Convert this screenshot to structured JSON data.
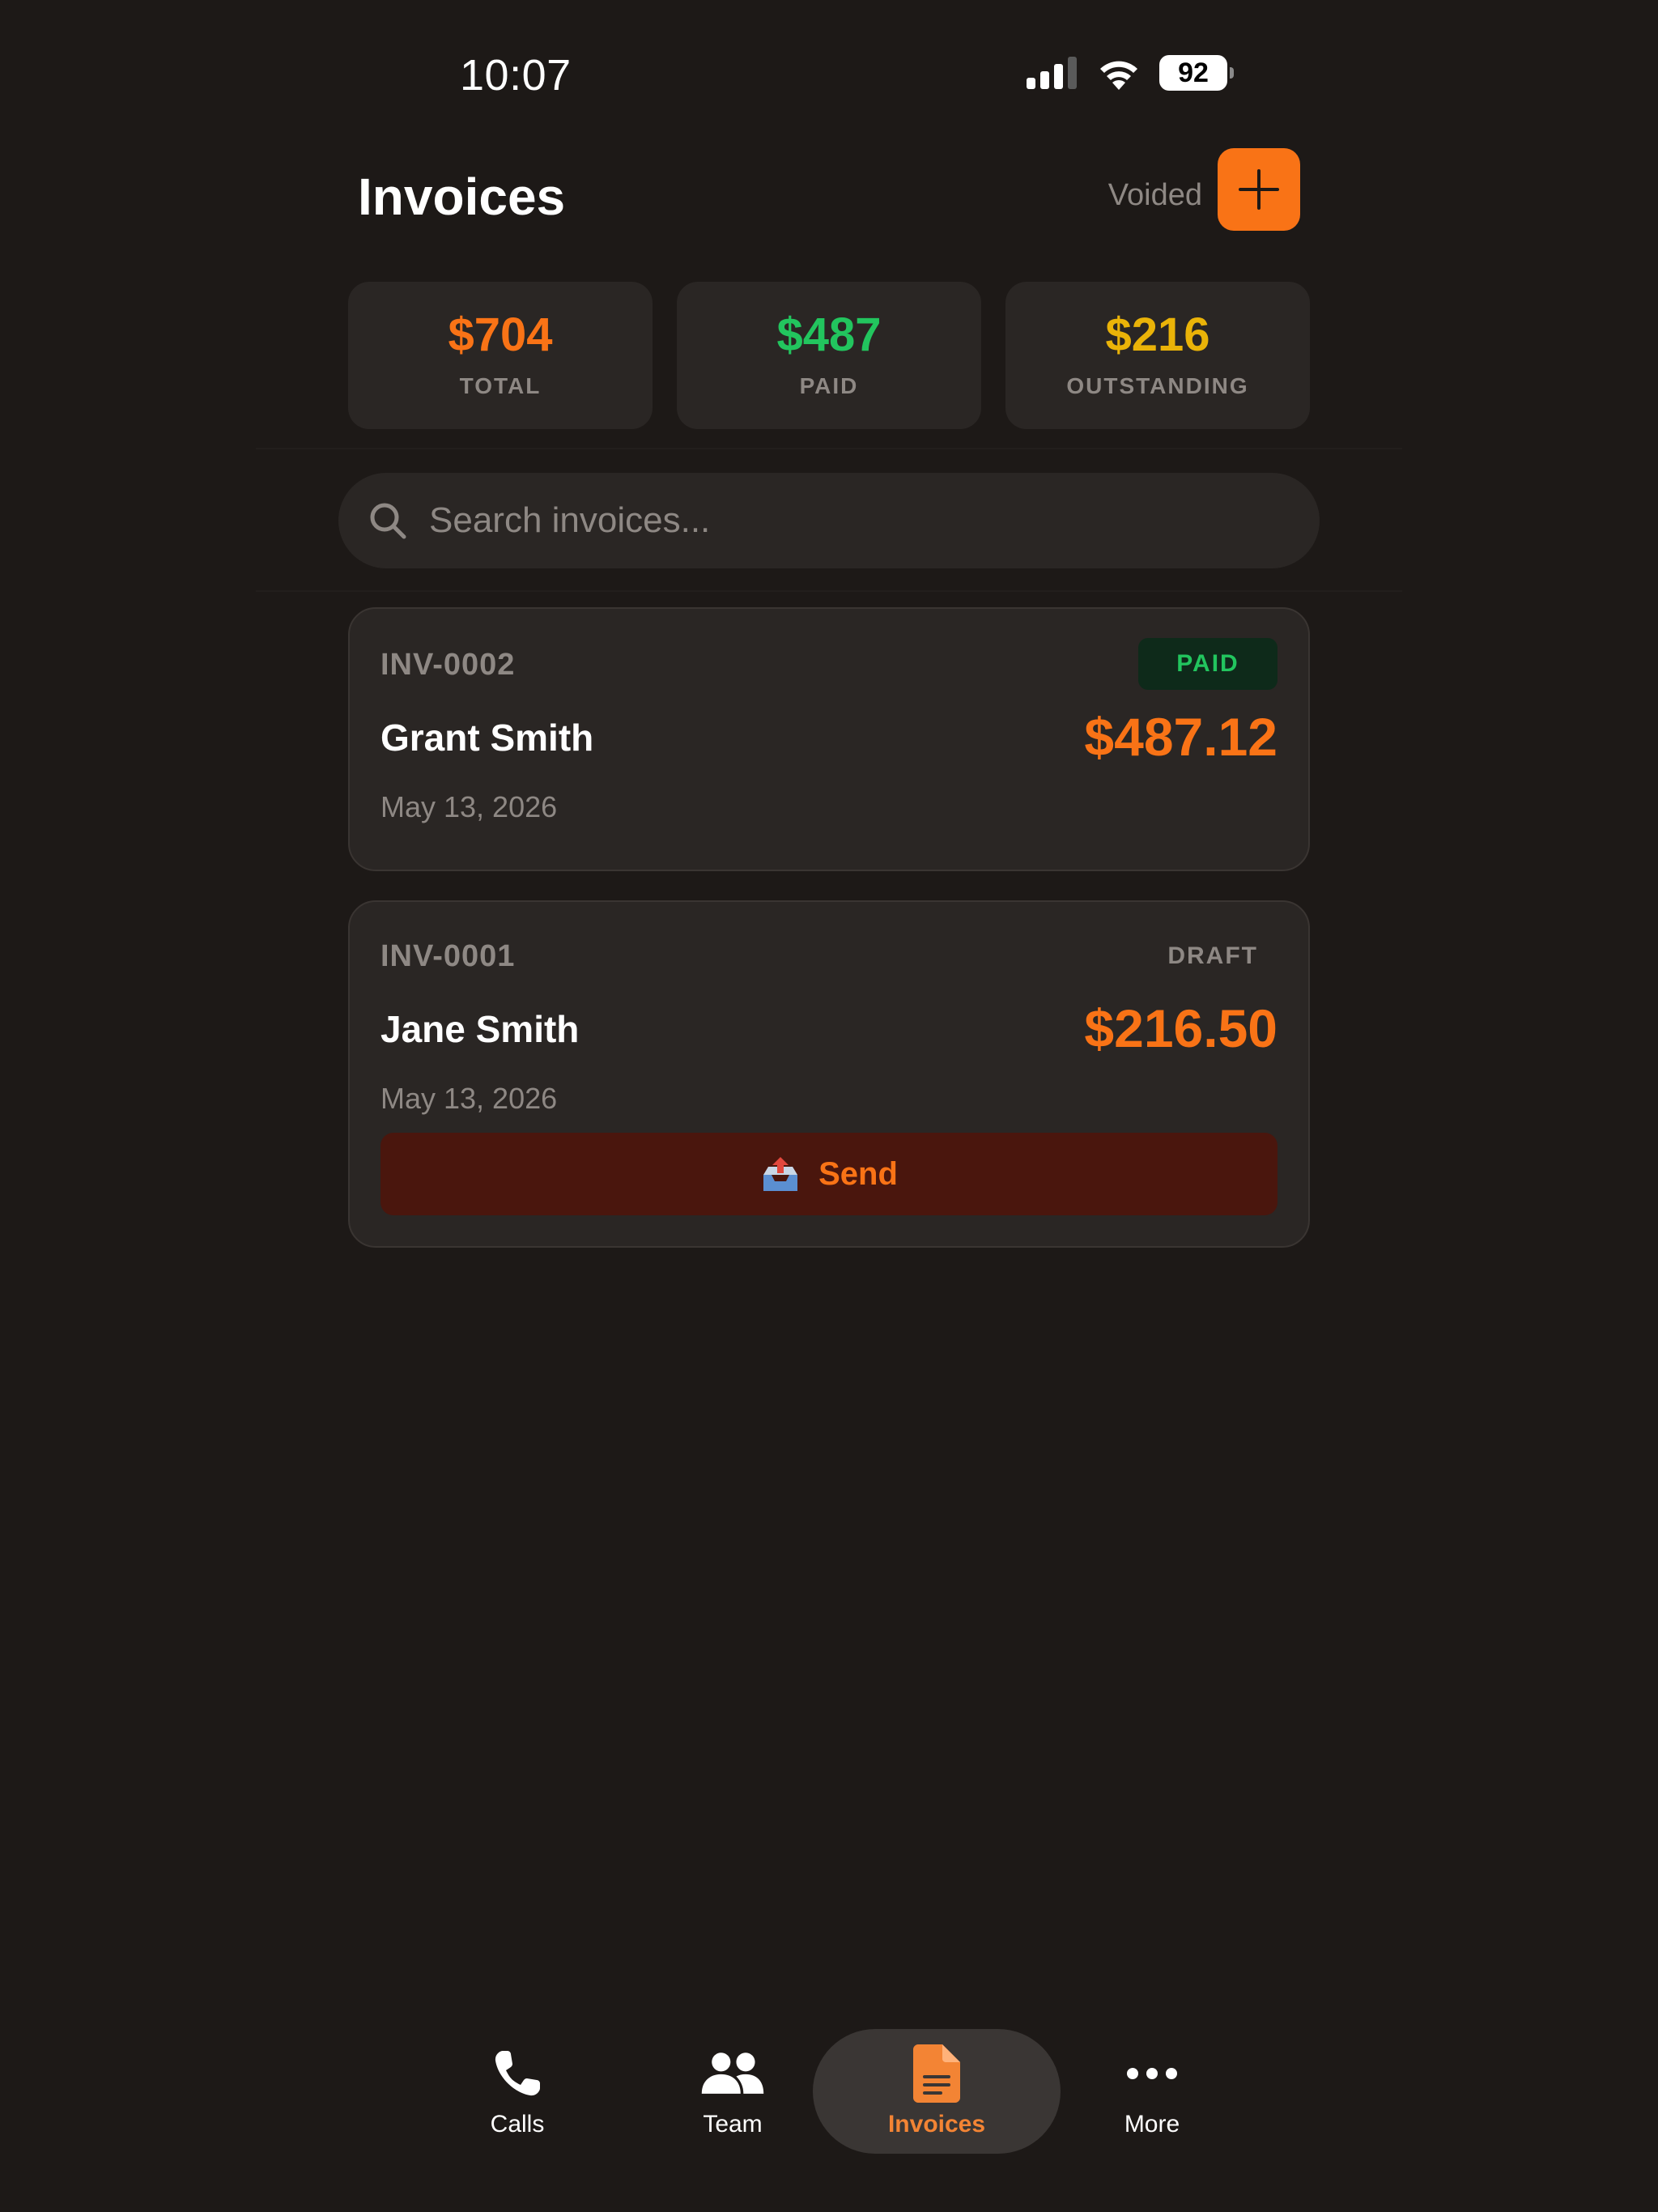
{
  "status_bar": {
    "time": "10:07",
    "battery": "92",
    "icons": [
      "cellular-signal-icon",
      "wifi-icon",
      "battery-icon"
    ]
  },
  "header": {
    "title": "Invoices",
    "voided_label": "Voided",
    "add_icon": "plus-icon"
  },
  "stats": [
    {
      "value": "$704",
      "label": "TOTAL",
      "color": "#f97316"
    },
    {
      "value": "$487",
      "label": "PAID",
      "color": "#22c55e"
    },
    {
      "value": "$216",
      "label": "OUTSTANDING",
      "color": "#eab308"
    }
  ],
  "search": {
    "placeholder": "Search invoices...",
    "value": "",
    "icon": "search-icon"
  },
  "invoices": [
    {
      "number": "INV-0002",
      "status": "PAID",
      "client": "Grant Smith",
      "amount": "$487.12",
      "date": "May 13, 2026"
    },
    {
      "number": "INV-0001",
      "status": "DRAFT",
      "client": "Jane Smith",
      "amount": "$216.50",
      "date": "May 13, 2026",
      "action_label": "Send",
      "action_icon": "outbox-tray-icon"
    }
  ],
  "tabs": [
    {
      "label": "Calls",
      "icon": "phone-icon",
      "active": false
    },
    {
      "label": "Team",
      "icon": "team-icon",
      "active": false
    },
    {
      "label": "Invoices",
      "icon": "document-icon",
      "active": true
    },
    {
      "label": "More",
      "icon": "more-icon",
      "active": false
    }
  ],
  "colors": {
    "background": "#1d1917",
    "card": "#2a2624",
    "accent": "#f97316",
    "paid": "#22c55e",
    "outstanding": "#eab308",
    "muted": "#8e8884"
  }
}
